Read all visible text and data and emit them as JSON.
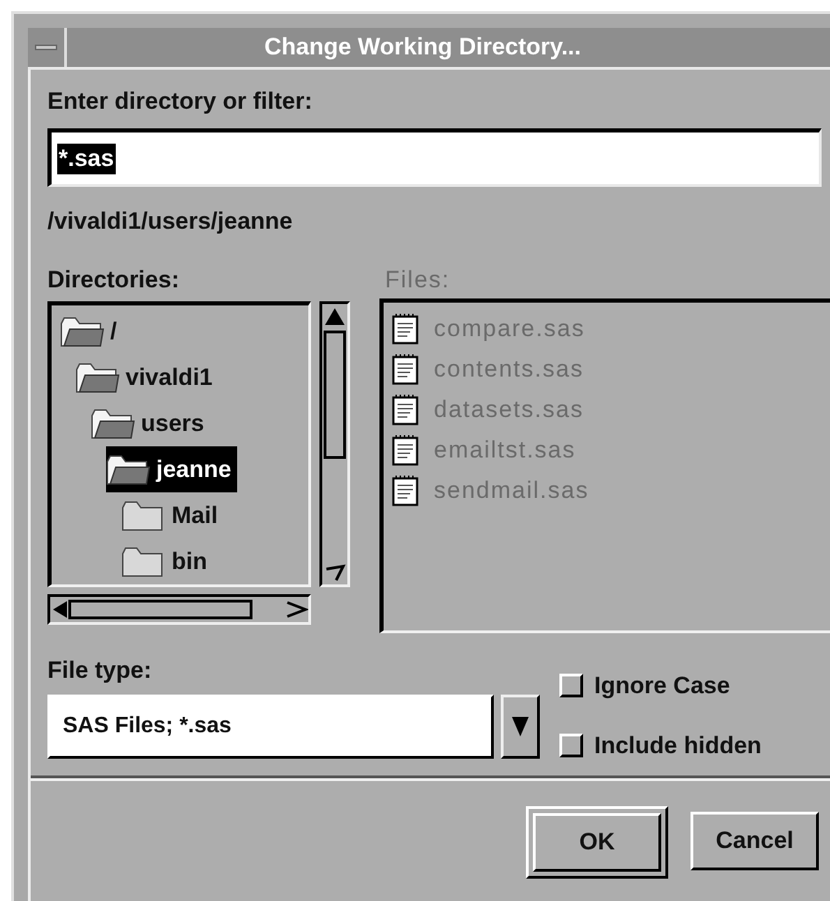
{
  "window": {
    "title": "Change Working Directory..."
  },
  "filter": {
    "label": "Enter directory or filter:",
    "value": "*.sas",
    "text_selected": true
  },
  "current_path": "/vivaldi1/users/jeanne",
  "directories": {
    "label": "Directories:",
    "items": [
      {
        "name": "/",
        "expanded": true,
        "selected": false,
        "children": [
          {
            "name": "vivaldi1",
            "expanded": true,
            "selected": false,
            "children": [
              {
                "name": "users",
                "expanded": true,
                "selected": false,
                "children": [
                  {
                    "name": "jeanne",
                    "expanded": true,
                    "selected": true,
                    "children": [
                      {
                        "name": "Mail",
                        "expanded": false,
                        "selected": false
                      },
                      {
                        "name": "bin",
                        "expanded": false,
                        "selected": false
                      }
                    ]
                  }
                ]
              }
            ]
          }
        ]
      }
    ]
  },
  "files": {
    "label": "Files:",
    "disabled": true,
    "items": [
      "compare.sas",
      "contents.sas",
      "datasets.sas",
      "emailtst.sas",
      "sendmail.sas"
    ]
  },
  "file_type": {
    "label": "File type:",
    "value": "SAS Files; *.sas"
  },
  "options": [
    {
      "label": "Ignore Case",
      "checked": false
    },
    {
      "label": "Include hidden",
      "checked": false
    }
  ],
  "buttons": [
    {
      "label": "OK",
      "default": true
    },
    {
      "label": "Cancel",
      "default": false
    }
  ]
}
